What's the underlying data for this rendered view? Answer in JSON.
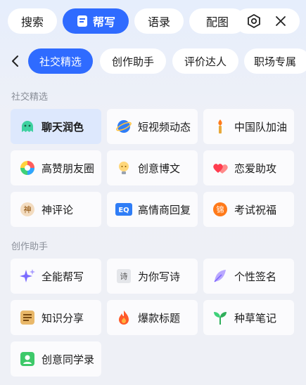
{
  "top_tabs": [
    "搜索",
    "帮写",
    "语录",
    "配图"
  ],
  "categories": [
    "社交精选",
    "创作助手",
    "评价达人",
    "职场专属"
  ],
  "sections": [
    {
      "title": "社交精选",
      "items": [
        "聊天润色",
        "短视频动态",
        "中国队加油",
        "高赞朋友圈",
        "创意博文",
        "恋爱助攻",
        "神评论",
        "高情商回复",
        "考试祝福"
      ]
    },
    {
      "title": "创作助手",
      "items": [
        "全能帮写",
        "为你写诗",
        "个性签名",
        "知识分享",
        "爆款标题",
        "种草笔记",
        "创意同学录"
      ]
    }
  ],
  "icon_texts": {
    "shen": "神",
    "eq": "EQ",
    "jin": "锦",
    "shi": "诗"
  },
  "colors": {
    "accent": "#2f6bff",
    "selected_card": "#dde8fd"
  }
}
